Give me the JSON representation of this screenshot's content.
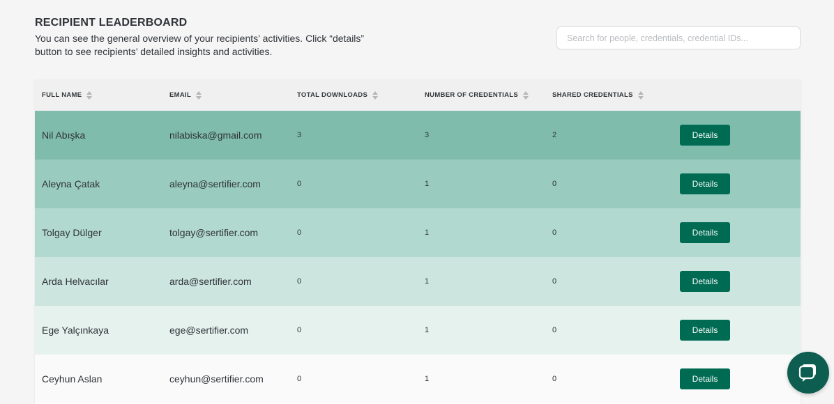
{
  "header": {
    "title": "RECIPIENT LEADERBOARD",
    "description": "You can see the general overview of your recipients’ activities. Click “details” button to see recipients’ detailed insights and activities."
  },
  "search": {
    "placeholder": "Search for people, credentials, credential IDs...",
    "value": ""
  },
  "table": {
    "columns": [
      {
        "label": "FULL NAME"
      },
      {
        "label": "EMAIL"
      },
      {
        "label": "TOTAL DOWNLOADS"
      },
      {
        "label": "NUMBER OF CREDENTIALS"
      },
      {
        "label": "SHARED CREDENTIALS"
      }
    ],
    "details_label": "Details",
    "rows": [
      {
        "name": "Nil Abışka",
        "email": "nilabiska@gmail.com",
        "downloads": "3",
        "credentials": "3",
        "shared": "2",
        "color": "#7fbcac"
      },
      {
        "name": "Aleyna Çatak",
        "email": "aleyna@sertifier.com",
        "downloads": "0",
        "credentials": "1",
        "shared": "0",
        "color": "#99cbbe"
      },
      {
        "name": "Tolgay Dülger",
        "email": "tolgay@sertifier.com",
        "downloads": "0",
        "credentials": "1",
        "shared": "0",
        "color": "#b2d9cf"
      },
      {
        "name": "Arda Helvacılar",
        "email": "arda@sertifier.com",
        "downloads": "0",
        "credentials": "1",
        "shared": "0",
        "color": "#cce5de"
      },
      {
        "name": "Ege Yalçınkaya",
        "email": "ege@sertifier.com",
        "downloads": "0",
        "credentials": "1",
        "shared": "0",
        "color": "#e5f2ee"
      },
      {
        "name": "Ceyhun Aslan",
        "email": "ceyhun@sertifier.com",
        "downloads": "0",
        "credentials": "1",
        "shared": "0",
        "color": "#fafafa"
      }
    ]
  },
  "chat": {
    "icon": "chat-bubble-icon",
    "color": "#0d5e50"
  },
  "colors": {
    "accent": "#006b53",
    "header_bg": "#f0f0f0",
    "page_bg": "#f5f5f5"
  }
}
